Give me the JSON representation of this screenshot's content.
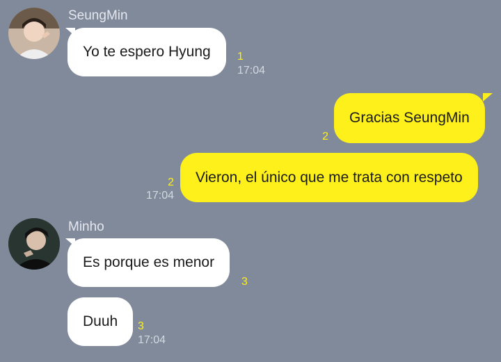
{
  "chat": {
    "colors": {
      "background": "#818a9b",
      "incoming_bubble": "#ffffff",
      "outgoing_bubble": "#fef01b",
      "unread_count": "#fef01b",
      "meta_text": "#d4d8e0"
    },
    "groups": [
      {
        "sender": "SeungMin",
        "avatar_icon": "avatar-seungmin",
        "messages": [
          {
            "text": "Yo te espero Hyung",
            "unread": "1",
            "time": "17:04"
          }
        ]
      },
      {
        "sender": "",
        "outgoing": true,
        "messages": [
          {
            "text": "Gracias SeungMin",
            "unread": "2",
            "time": ""
          },
          {
            "text": "Vieron, el único que me trata con respeto",
            "unread": "2",
            "time": "17:04"
          }
        ]
      },
      {
        "sender": "Minho",
        "avatar_icon": "avatar-minho",
        "messages": [
          {
            "text": "Es porque es menor",
            "unread": "3",
            "time": ""
          },
          {
            "text": "Duuh",
            "unread": "3",
            "time": "17:04"
          }
        ]
      }
    ]
  }
}
